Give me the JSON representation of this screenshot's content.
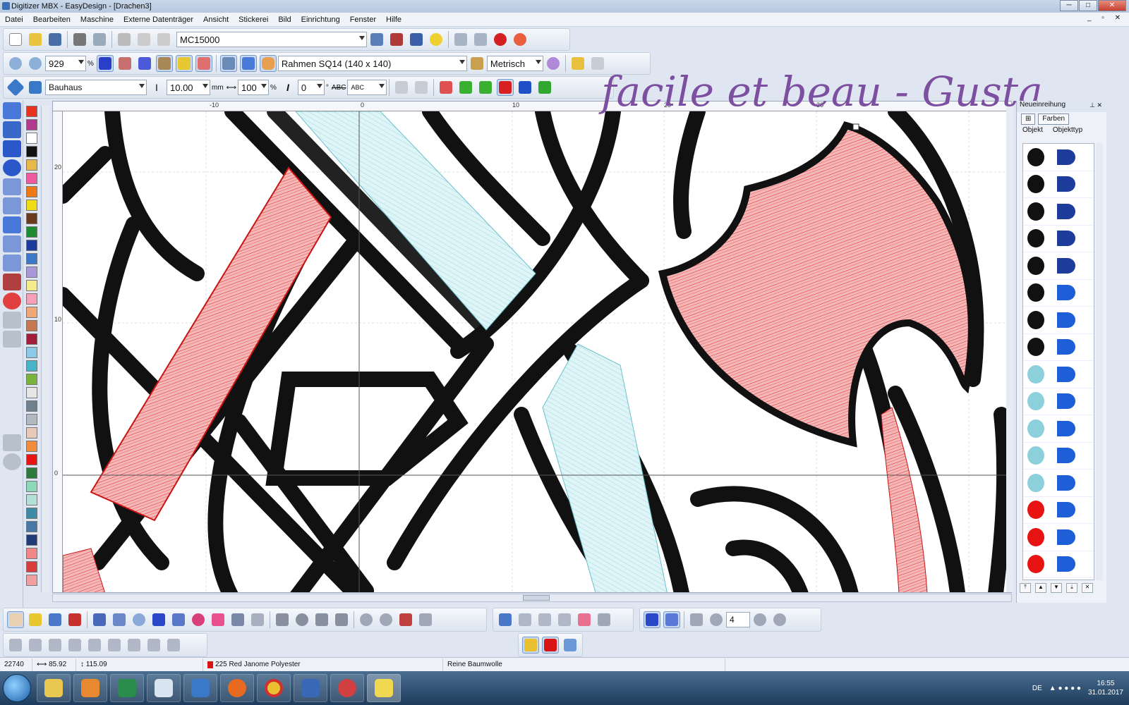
{
  "window": {
    "title": "Digitizer MBX - EasyDesign - [Drachen3]",
    "btn_min": "─",
    "btn_max": "□",
    "btn_close": "✕"
  },
  "menu": [
    "Datei",
    "Bearbeiten",
    "Maschine",
    "Externe Datenträger",
    "Ansicht",
    "Stickerei",
    "Bild",
    "Einrichtung",
    "Fenster",
    "Hilfe"
  ],
  "mdi_controls": "_ ▫ ✕",
  "toolbar1": {
    "machine": "MC15000"
  },
  "toolbar2": {
    "zoom": "929",
    "zoom_unit": "%",
    "hoop": "Rahmen SQ14 (140 x 140)",
    "units": "Metrisch"
  },
  "toolbar3": {
    "font": "Bauhaus",
    "size": "10.00",
    "size_unit": "mm",
    "width": "100",
    "width_unit": "%",
    "angle": "0",
    "angle_unit": "°",
    "abc1": "ABC",
    "abc2": "ABC"
  },
  "ruler": {
    "h": [
      "-10",
      "0",
      "10",
      "20",
      "30"
    ],
    "v": [
      "20",
      "10",
      "0"
    ]
  },
  "palette": [
    "#e8321e",
    "#b03a8c",
    "#ffffff",
    "#111111",
    "#e8b84a",
    "#f05aa0",
    "#f07814",
    "#f0dc14",
    "#6b3a1e",
    "#1e8c2e",
    "#1e3c9c",
    "#3c78c8",
    "#a898d8",
    "#f4ec8c",
    "#f4a0b8",
    "#f0a878",
    "#c87850",
    "#a01e3c",
    "#8cc8e8",
    "#48b4c8",
    "#78b43c",
    "#e6e6e6",
    "#708090",
    "#b0b8c0",
    "#e8c8b8",
    "#f08c3c",
    "#e81414",
    "#2e7a3c",
    "#8cd8b8",
    "#b4e0d8",
    "#3c8ca8",
    "#4878a8",
    "#203c78",
    "#f08888",
    "#d83c3c",
    "#f0a0a0"
  ],
  "watermark": "facile et beau - Gusta",
  "right_panel": {
    "header": "Neueinreihung",
    "farben": "Farben",
    "tab_obj": "Objekt",
    "tab_type": "Objekttyp"
  },
  "obj_rows": [
    {
      "left": "#111111",
      "right": "#1e3c9c"
    },
    {
      "left": "#111111",
      "right": "#1e3c9c"
    },
    {
      "left": "#111111",
      "right": "#1e3c9c"
    },
    {
      "left": "#111111",
      "right": "#1e3c9c"
    },
    {
      "left": "#111111",
      "right": "#1e3c9c"
    },
    {
      "left": "#111111",
      "right": "#1e5fd8"
    },
    {
      "left": "#111111",
      "right": "#1e5fd8"
    },
    {
      "left": "#111111",
      "right": "#1e5fd8"
    },
    {
      "left": "#8cd0dc",
      "right": "#1e5fd8"
    },
    {
      "left": "#8cd0dc",
      "right": "#1e5fd8"
    },
    {
      "left": "#8cd0dc",
      "right": "#1e5fd8"
    },
    {
      "left": "#8cd0dc",
      "right": "#1e5fd8"
    },
    {
      "left": "#8cd0dc",
      "right": "#1e5fd8"
    },
    {
      "left": "#e81414",
      "right": "#1e5fd8"
    },
    {
      "left": "#e81414",
      "right": "#1e5fd8"
    },
    {
      "left": "#e81414",
      "right": "#1e5fd8"
    }
  ],
  "bottom": {
    "count": "4"
  },
  "status": {
    "stitches": "22740",
    "width": "85.92",
    "height": "115.09",
    "thread": "225 Red Janome Polyester",
    "material": "Reine Baumwolle"
  },
  "tray": {
    "lang": "DE",
    "time": "16:55",
    "date": "31.01.2017"
  }
}
